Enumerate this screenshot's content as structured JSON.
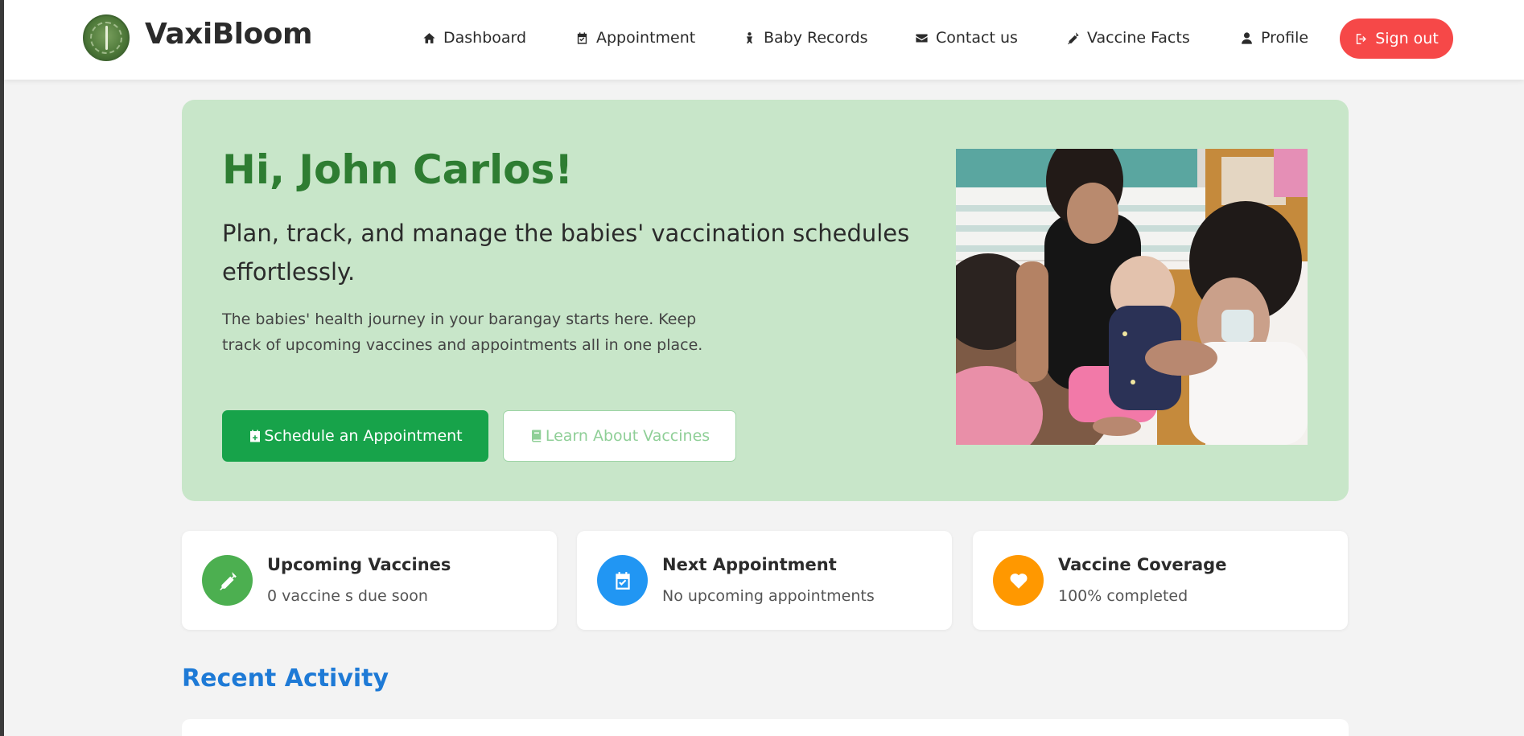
{
  "app": {
    "name": "VaxiBloom"
  },
  "nav": {
    "items": [
      {
        "label": "Dashboard",
        "icon": "home-icon"
      },
      {
        "label": "Appointment",
        "icon": "calendar-check-icon"
      },
      {
        "label": "Baby Records",
        "icon": "baby-icon"
      },
      {
        "label": "Contact us",
        "icon": "envelope-icon"
      },
      {
        "label": "Vaccine Facts",
        "icon": "syringe-icon"
      },
      {
        "label": "Profile",
        "icon": "user-icon"
      }
    ],
    "signout_label": "Sign out"
  },
  "hero": {
    "greeting": "Hi, John Carlos!",
    "subtitle": "Plan, track, and manage the babies' vaccination schedules effortlessly.",
    "description": "The babies' health journey in your barangay starts here. Keep track of upcoming vaccines and appointments all in one place.",
    "primary_button": "Schedule an Appointment",
    "secondary_button": "Learn About Vaccines"
  },
  "cards": [
    {
      "title": "Upcoming Vaccines",
      "text": "0 vaccine s due soon",
      "icon": "syringe-icon",
      "color": "#4caf50"
    },
    {
      "title": "Next Appointment",
      "text": "No upcoming appointments",
      "icon": "calendar-check-icon",
      "color": "#2196f3"
    },
    {
      "title": "Vaccine Coverage",
      "text": "100% completed",
      "icon": "heart-icon",
      "color": "#ff9800"
    }
  ],
  "recent_activity": {
    "title": "Recent Activity"
  },
  "colors": {
    "brand_green": "#2e7d32",
    "hero_bg": "#c8e6c9",
    "primary_button": "#17a34a",
    "signout": "#f64848",
    "section_title": "#1e7ad6"
  }
}
